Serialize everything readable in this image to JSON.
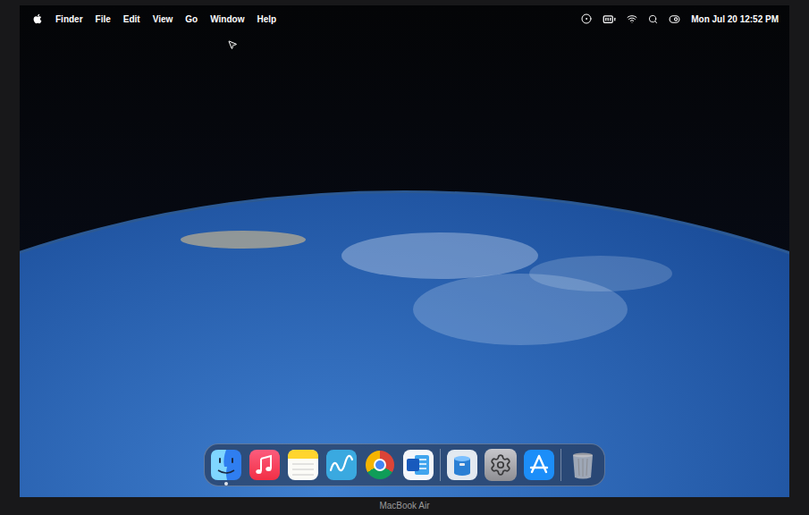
{
  "menu_bar": {
    "app": "Finder",
    "menus": [
      "File",
      "Edit",
      "View",
      "Go",
      "Window",
      "Help"
    ],
    "clock": "Mon Jul 20 12:52 PM"
  },
  "dock": {
    "sections": [
      [
        {
          "kind": "finder",
          "running": true
        },
        {
          "kind": "music",
          "running": false
        },
        {
          "kind": "notes",
          "running": false
        },
        {
          "kind": "freeform",
          "running": false
        },
        {
          "kind": "chrome",
          "running": false
        },
        {
          "kind": "word",
          "running": false
        }
      ],
      [
        {
          "kind": "disk",
          "running": false
        },
        {
          "kind": "settings",
          "running": false
        },
        {
          "kind": "appstore",
          "running": false
        }
      ],
      [
        {
          "kind": "trash",
          "running": false
        }
      ]
    ]
  },
  "bezel": {
    "label": "MacBook Air"
  }
}
